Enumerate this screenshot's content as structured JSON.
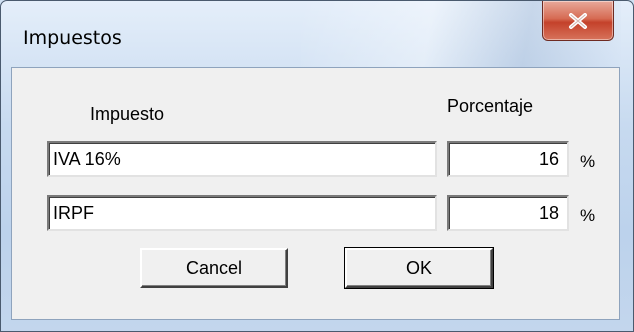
{
  "window": {
    "title": "Impuestos"
  },
  "headers": {
    "tax": "Impuesto",
    "percent": "Porcentaje"
  },
  "rows": [
    {
      "name": "IVA 16%",
      "percent": "16",
      "unit": "%"
    },
    {
      "name": "IRPF",
      "percent": "18",
      "unit": "%"
    }
  ],
  "buttons": {
    "cancel": "Cancel",
    "ok": "OK"
  },
  "icons": {
    "close": "close-icon"
  },
  "colors": {
    "close_button": "#c4412a",
    "titlebar": "#c6d9ef",
    "client": "#f0f0f0"
  }
}
